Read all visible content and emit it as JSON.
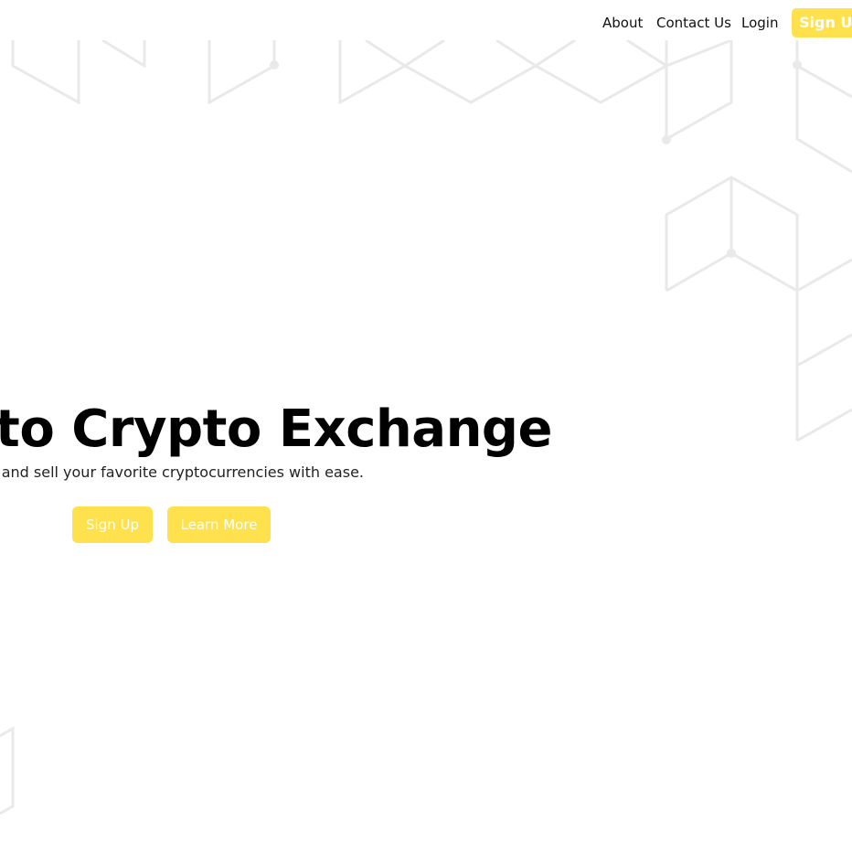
{
  "nav": {
    "about": "About",
    "contact": "Contact Us",
    "login": "Login",
    "signup": "Sign Up"
  },
  "hero": {
    "title": "Welcome to Crypto Exchange",
    "subtitle": "Buy and sell your favorite cryptocurrencies with ease.",
    "signup_button": "Sign Up",
    "learn_more_button": "Learn More"
  },
  "colors": {
    "accent": "#ffe14d",
    "pattern": "#e9e9e9",
    "text": "#000000",
    "background": "#ffffff"
  },
  "icons": {
    "background": "hexagon-network-pattern"
  }
}
